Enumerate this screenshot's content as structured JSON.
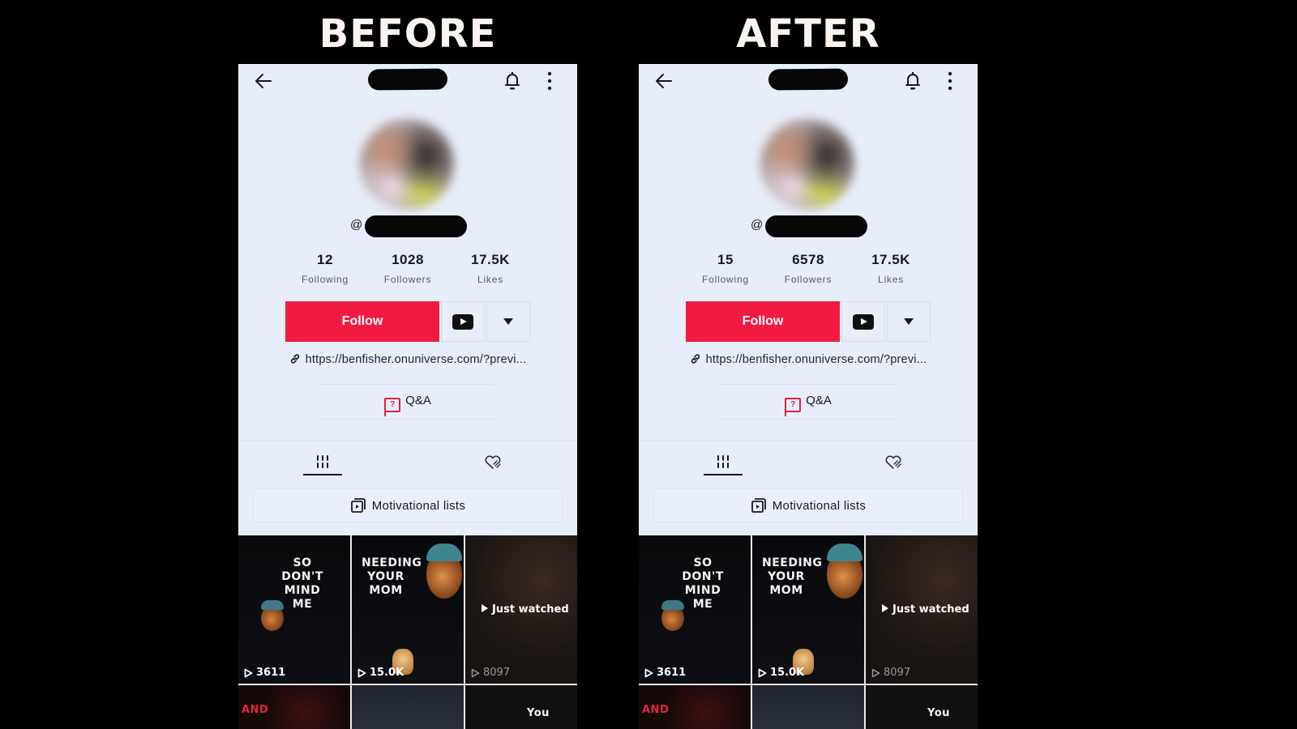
{
  "panels": [
    {
      "heading": "BEFORE",
      "profile": {
        "at_prefix": "@",
        "stats": [
          {
            "value": "12",
            "label": "Following"
          },
          {
            "value": "1028",
            "label": "Followers"
          },
          {
            "value": "17.5K",
            "label": "Likes"
          }
        ],
        "follow_label": "Follow",
        "link_text": "https://benfisher.onuniverse.com/?previ...",
        "qa_label": "Q&A",
        "qa_icon_glyph": "?",
        "playlist_label": "Motivational lists"
      },
      "videos": [
        {
          "caption": "SO DON'T MIND ME",
          "views": "3611"
        },
        {
          "caption": "NEEDING YOUR MOM",
          "views": "15.0K"
        },
        {
          "badge": "Just watched",
          "views": "8097"
        },
        {
          "caption": "AND"
        },
        {
          "caption": ""
        },
        {
          "caption": "You"
        }
      ]
    },
    {
      "heading": "AFTER",
      "profile": {
        "at_prefix": "@",
        "stats": [
          {
            "value": "15",
            "label": "Following"
          },
          {
            "value": "6578",
            "label": "Followers"
          },
          {
            "value": "17.5K",
            "label": "Likes"
          }
        ],
        "follow_label": "Follow",
        "link_text": "https://benfisher.onuniverse.com/?previ...",
        "qa_label": "Q&A",
        "qa_icon_glyph": "?",
        "playlist_label": "Motivational lists"
      },
      "videos": [
        {
          "caption": "SO DON'T MIND ME",
          "views": "3611"
        },
        {
          "caption": "NEEDING YOUR MOM",
          "views": "15.0K"
        },
        {
          "badge": "Just watched",
          "views": "8097"
        },
        {
          "caption": "AND"
        },
        {
          "caption": ""
        },
        {
          "caption": "You"
        }
      ]
    }
  ],
  "colors": {
    "follow_red": "#f01a42",
    "qa_red": "#e3213e",
    "panel_bg": "#e8eef9",
    "page_bg": "#000000"
  },
  "icons": {
    "back": "arrow-left",
    "notifications": "bell",
    "more": "vertical-ellipsis",
    "youtube": "youtube-play",
    "dropdown": "caret-down",
    "link": "chain-link",
    "qa": "question-bubble",
    "videos_tab": "grid-bars",
    "liked_tab": "heart-hand",
    "playlist": "playlist-play"
  }
}
